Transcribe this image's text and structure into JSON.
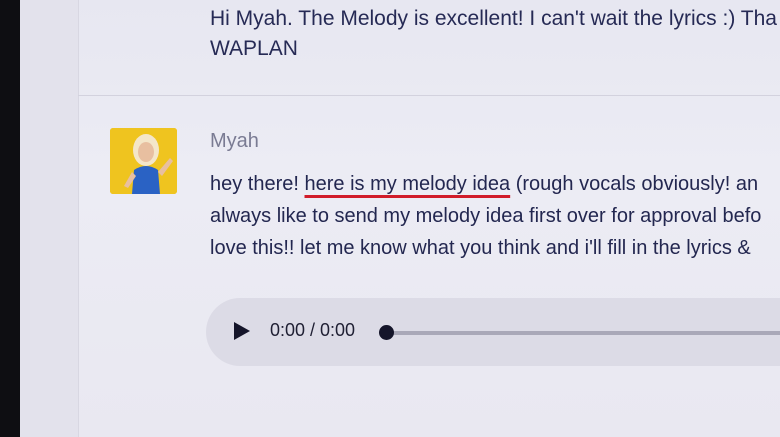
{
  "previous_message": {
    "line1": "Hi Myah. The Melody is excellent! I can't wait the lyrics :) Tha",
    "line2": "WAPLAN"
  },
  "message": {
    "sender": "Myah",
    "line1_prefix": "hey there! ",
    "link_text": "here is my melody idea",
    "line1_suffix": " (rough vocals obviously! an",
    "line2": "always like to send my melody idea first over for approval befo",
    "line3": "love this!! let me know what you think and i'll fill in the lyrics &"
  },
  "audio_player": {
    "time": "0:00 / 0:00",
    "progress": 0
  }
}
